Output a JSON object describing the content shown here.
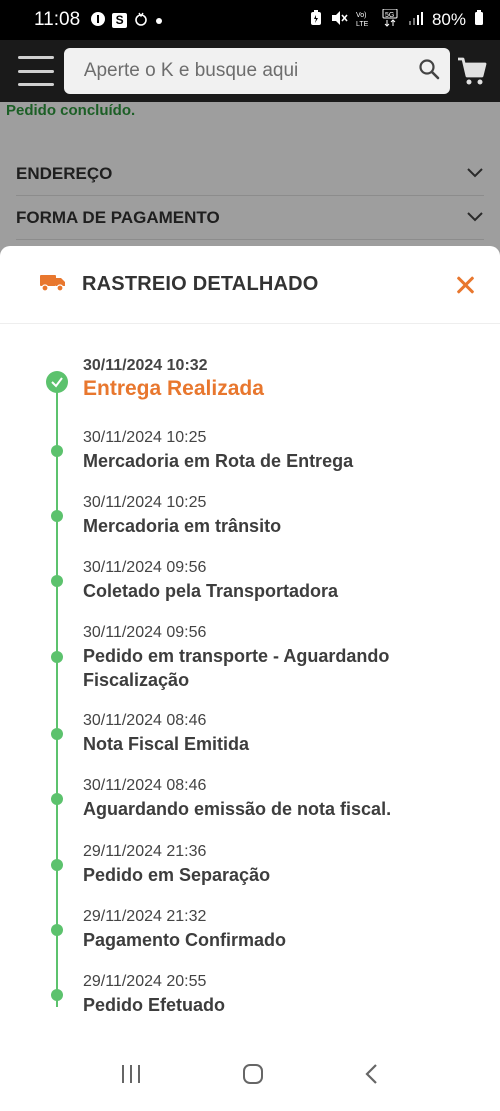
{
  "status_bar": {
    "time": "11:08",
    "battery": "80%",
    "icons": [
      "vpn-icon",
      "s-icon",
      "hand-icon",
      "dot-icon",
      "battery-saver-icon",
      "mute-icon",
      "volte-icon",
      "5g-icon",
      "signal-icon",
      "battery-icon"
    ]
  },
  "header": {
    "search_placeholder": "Aperte o K e busque aqui"
  },
  "page": {
    "status": "Pedido concluído.",
    "sections": [
      "ENDEREÇO",
      "FORMA DE PAGAMENTO"
    ]
  },
  "tracking": {
    "title": "RASTREIO DETALHADO",
    "events": [
      {
        "date": "30/11/2024 10:32",
        "title": "Entrega Realizada"
      },
      {
        "date": "30/11/2024 10:25",
        "title": "Mercadoria em Rota de Entrega"
      },
      {
        "date": "30/11/2024 10:25",
        "title": "Mercadoria em trânsito"
      },
      {
        "date": "30/11/2024 09:56",
        "title": "Coletado pela Transportadora"
      },
      {
        "date": "30/11/2024 09:56",
        "title": "Pedido em transporte - Aguardando Fiscalização"
      },
      {
        "date": "30/11/2024 08:46",
        "title": "Nota Fiscal Emitida"
      },
      {
        "date": "30/11/2024 08:46",
        "title": "Aguardando emissão de nota fiscal."
      },
      {
        "date": "29/11/2024 21:36",
        "title": "Pedido em Separação"
      },
      {
        "date": "29/11/2024 21:32",
        "title": "Pagamento Confirmado"
      },
      {
        "date": "29/11/2024 20:55",
        "title": "Pedido Efetuado"
      }
    ]
  },
  "colors": {
    "accent": "#e8772e",
    "success": "#5cc26d"
  }
}
